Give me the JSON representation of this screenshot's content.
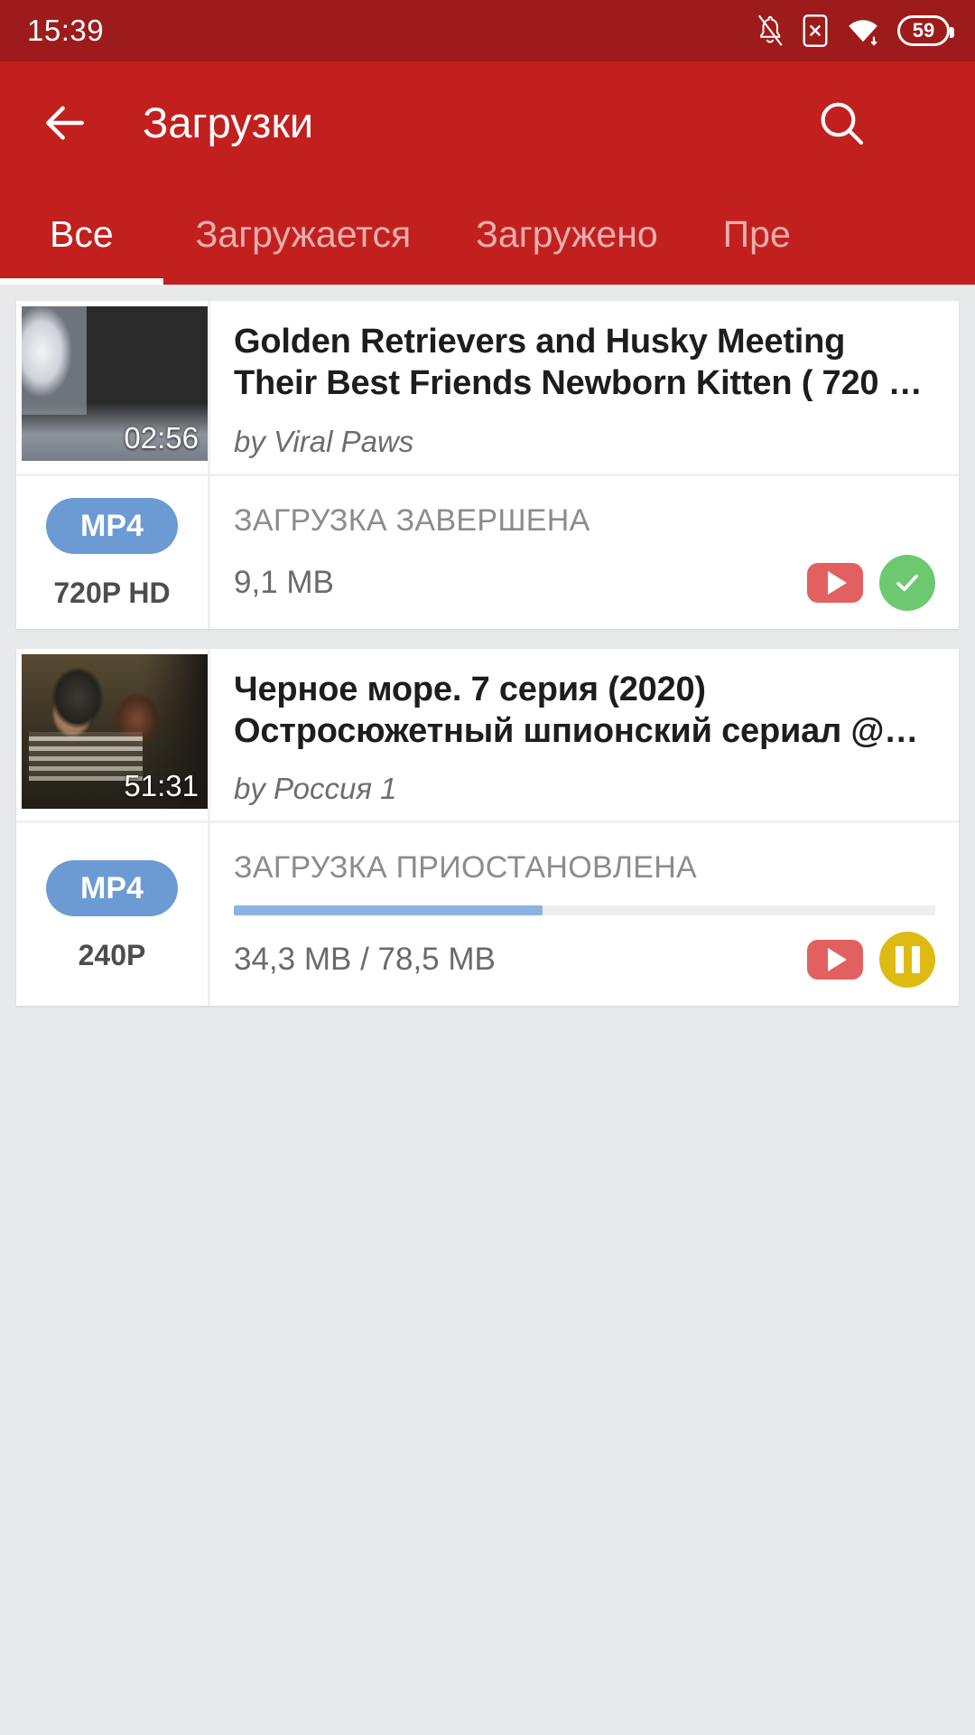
{
  "statusbar": {
    "time": "15:39",
    "battery_level": "59",
    "icons": [
      "bell-muted-icon",
      "sim-x-icon",
      "wifi-icon",
      "battery-icon"
    ]
  },
  "appbar": {
    "title": "Загрузки",
    "back_icon": "back-arrow-icon",
    "search_icon": "search-icon",
    "menu_icon": "overflow-menu-icon",
    "background_color": "#c2201e"
  },
  "tabs": {
    "items": [
      {
        "label": "Все",
        "active": true
      },
      {
        "label": "Загружается",
        "active": false
      },
      {
        "label": "Загружено",
        "active": false
      },
      {
        "label": "Пре",
        "active": false
      }
    ]
  },
  "downloads": [
    {
      "duration": "02:56",
      "title": "Golden Retrievers and Husky Meeting Their Best Friends Newborn Kitten ( 720 …",
      "author": "by Viral Paws",
      "format": "MP4",
      "quality": "720P HD",
      "state": "ЗАГРУЗКА ЗАВЕРШЕНА",
      "size": "9,1 MB",
      "progress_percent": 100,
      "show_progress": false,
      "action_icon": "check-circle-icon",
      "play_icon": "youtube-play-icon"
    },
    {
      "duration": "51:31",
      "title": "Черное море. 7 серия (2020) Остросюжетный шпионский сериал @…",
      "author": "by Россия 1",
      "format": "MP4",
      "quality": "240P",
      "state": "ЗАГРУЗКА ПРИОСТАНОВЛЕНА",
      "size": "34,3 MB / 78,5 MB",
      "progress_percent": 44,
      "show_progress": true,
      "action_icon": "pause-circle-icon",
      "play_icon": "youtube-play-icon"
    }
  ],
  "colors": {
    "status_bar": "#9d1b1a",
    "app_bar": "#c2201e",
    "page_background": "#e7e9ea",
    "format_pill": "#6b9bd2",
    "progress_fill": "#8ab4de",
    "done_badge": "#6cc96f",
    "paused_badge": "#ddbb13",
    "youtube_button": "#e2605f"
  }
}
